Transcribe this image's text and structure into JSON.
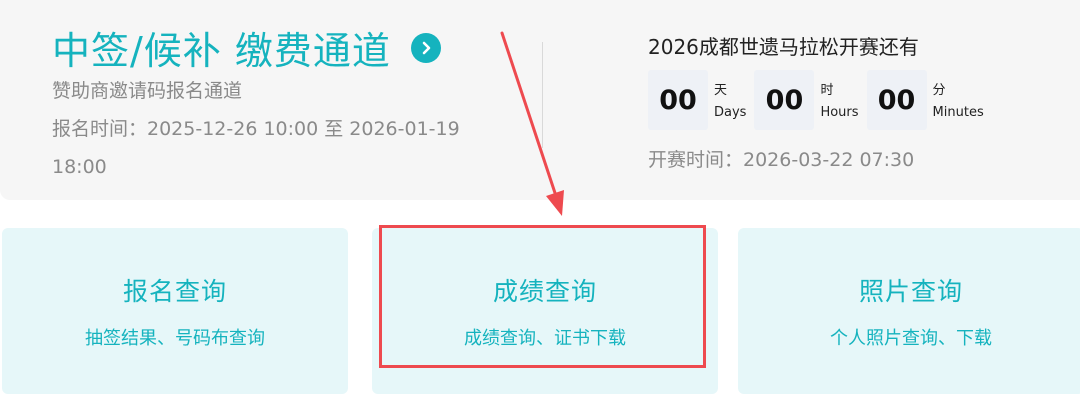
{
  "header": {
    "title": "中签/候补 缴费通道",
    "subtitle": "赞助商邀请码报名通道",
    "reg_time": "报名时间：2025-12-26 10:00 至 2026-01-19 18:00"
  },
  "countdown": {
    "title": "2026成都世遗马拉松开赛还有",
    "units": [
      {
        "value": "00",
        "zh": "天",
        "en": "Days"
      },
      {
        "value": "00",
        "zh": "时",
        "en": "Hours"
      },
      {
        "value": "00",
        "zh": "分",
        "en": "Minutes"
      }
    ],
    "start_time": "开赛时间：2026-03-22 07:30"
  },
  "cards": [
    {
      "title": "报名查询",
      "sub": "抽签结果、号码布查询"
    },
    {
      "title": "成绩查询",
      "sub": "成绩查询、证书下载"
    },
    {
      "title": "照片查询",
      "sub": "个人照片查询、下载"
    }
  ],
  "colors": {
    "accent": "#15b3be",
    "annotation": "#ee4a4f",
    "panel": "#f6f6f6",
    "card": "#e6f7f9"
  },
  "icons": {
    "title_arrow": "chevron-right-icon",
    "annotation_arrow": "annotation-arrow-icon"
  }
}
